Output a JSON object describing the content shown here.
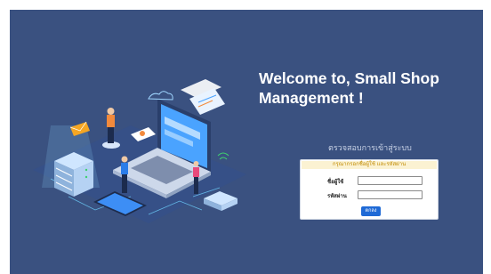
{
  "heading": {
    "line1": "Welcome to, Small Shop",
    "line2": "Management !"
  },
  "subtitle": "ตรวจสอบการเข้าสู่ระบบ",
  "login": {
    "header": "กรุณากรอกชื่อผู้ใช้ และรหัสผ่าน",
    "username_label": "ชื่อผู้ใช้",
    "username_value": "",
    "password_label": "รหัสผ่าน",
    "password_value": "",
    "submit_label": "ตกลง"
  },
  "colors": {
    "background": "#3a5180",
    "header_bg": "#fbf2d2",
    "header_text": "#c08a00",
    "button": "#1f6ad6"
  }
}
